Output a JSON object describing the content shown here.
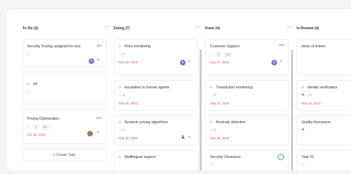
{
  "columns": [
    {
      "title": "To Do (3)",
      "menu": "···",
      "cards": [
        {
          "title": "Security Testing assigned for test",
          "tag": "3/3",
          "avatar": "S"
        },
        {
          "title": "ed"
        },
        {
          "title": "Pricing Optimization",
          "badge": "2Ai",
          "chip1": "0",
          "chip2": "0/3",
          "date": "Oct 28, 2023"
        }
      ],
      "create": "+ Create Task"
    },
    {
      "title": "Doing (7)",
      "menu": "···",
      "cards": [
        {
          "title": "Price monitoring",
          "sub": "0",
          "date": "Nov 16, 2023",
          "avatar": "S"
        },
        {
          "title": "Escalation to human agents",
          "sub": "0",
          "date": "Sep 22, 2023"
        },
        {
          "title": "Dynamic pricing algorithms",
          "sub": "0",
          "date": "Sep 30, 2023"
        },
        {
          "title": "Multilingual support"
        }
      ]
    },
    {
      "title": "Done (4)",
      "menu": "···",
      "cards": [
        {
          "title": "Customer Support",
          "badge": "2Ai",
          "chip1": "0",
          "chip2": "0/3",
          "date": "Sep 27, 2023",
          "avatar": "S"
        },
        {
          "title": "Transaction monitoring",
          "sub": "0",
          "date": "Sep 22, 2023"
        },
        {
          "title": "Anomaly detection",
          "sub": "0",
          "date": "Sep 28, 2023"
        },
        {
          "title": "Security Clearance",
          "check": "✓"
        }
      ]
    },
    {
      "title": "In Review (4)",
      "cards": [
        {
          "title": "Issue of tickets"
        },
        {
          "title": "Identity verification",
          "sub": "0",
          "date": "Sep 23, 2023"
        },
        {
          "title": "Quality Assurance"
        },
        {
          "title": "Task 01"
        }
      ]
    }
  ],
  "colors": {
    "accent": "#8b6fd6",
    "date": "#e5484d",
    "star": "#f5b400",
    "ai": "#5b8def",
    "check": "#3fb46a"
  }
}
